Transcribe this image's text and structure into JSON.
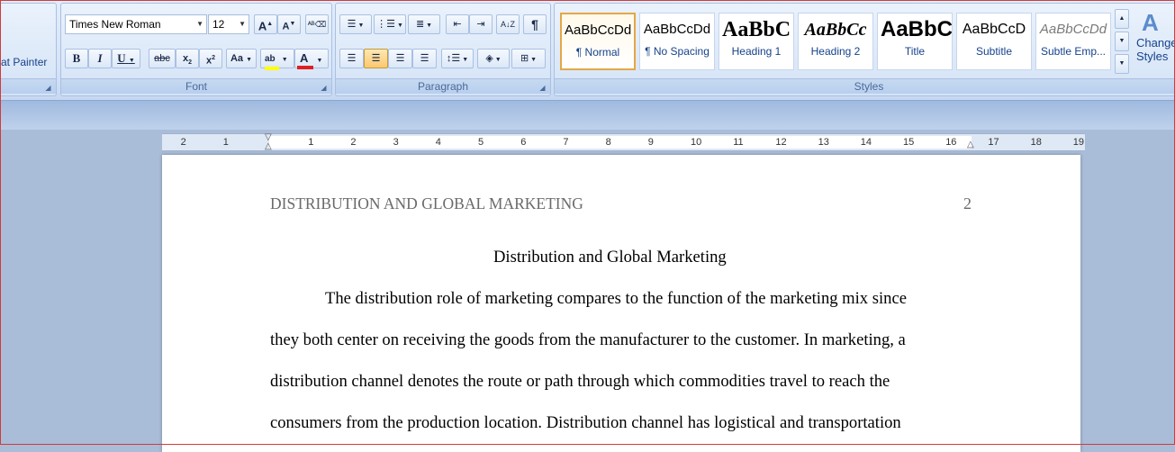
{
  "clipboard": {
    "format_painter_label": "at Painter"
  },
  "font": {
    "group_label": "Font",
    "font_name": "Times New Roman",
    "font_size": "12",
    "grow_label": "A",
    "shrink_label": "A",
    "bold": "B",
    "italic": "I",
    "underline": "U",
    "strikethrough": "abc",
    "subscript": "x",
    "superscript": "x",
    "change_case": "Aa",
    "highlight_label": "ab",
    "font_color_label": "A",
    "highlight_color": "#ffff00",
    "font_color": "#e02020"
  },
  "paragraph": {
    "group_label": "Paragraph",
    "pilcrow": "¶"
  },
  "styles": {
    "group_label": "Styles",
    "change_styles_label_1": "Change",
    "change_styles_label_2": "Styles",
    "items": [
      {
        "sample": "AaBbCcDd",
        "name": "¶ Normal"
      },
      {
        "sample": "AaBbCcDd",
        "name": "¶ No Spacing"
      },
      {
        "sample": "AaBbC",
        "name": "Heading 1"
      },
      {
        "sample": "AaBbCc",
        "name": "Heading 2"
      },
      {
        "sample": "AaBbC",
        "name": "Title"
      },
      {
        "sample": "AaBbCcD",
        "name": "Subtitle"
      },
      {
        "sample": "AaBbCcDd",
        "name": "Subtle Emp..."
      }
    ]
  },
  "ruler": {
    "numbers": [
      "2",
      "1",
      "1",
      "2",
      "3",
      "4",
      "5",
      "6",
      "7",
      "8",
      "9",
      "10",
      "11",
      "12",
      "13",
      "14",
      "15",
      "16",
      "17",
      "18",
      "19"
    ]
  },
  "document": {
    "header_title": "DISTRIBUTION AND GLOBAL MARKETING",
    "page_number": "2",
    "title": "Distribution and Global Marketing",
    "lines": [
      "The distribution role of marketing compares to the function of the marketing mix since",
      "they both center on receiving the goods from the manufacturer to the customer. In marketing, a",
      "distribution channel denotes the route or path through which commodities travel to reach the",
      "consumers from the production location. Distribution channel has logistical and transportation"
    ]
  }
}
